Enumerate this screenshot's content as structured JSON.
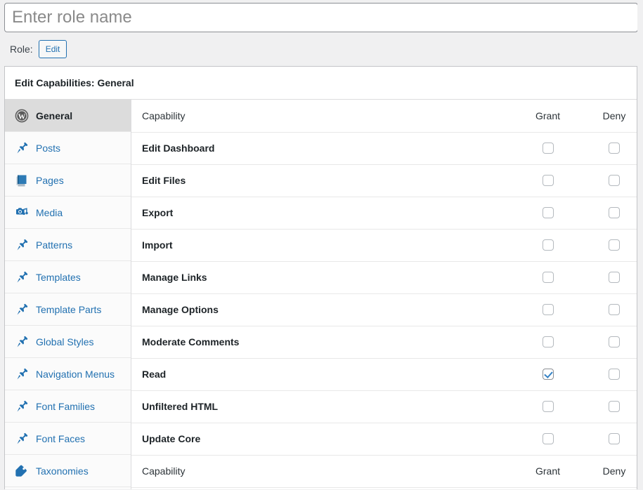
{
  "role_name_input": {
    "placeholder": "Enter role name",
    "value": ""
  },
  "role_line": {
    "label": "Role:",
    "edit_button": "Edit"
  },
  "panel": {
    "title": "Edit Capabilities: General"
  },
  "sidebar": {
    "items": [
      {
        "label": "General",
        "icon": "wordpress-icon",
        "active": true
      },
      {
        "label": "Posts",
        "icon": "pushpin-icon",
        "active": false
      },
      {
        "label": "Pages",
        "icon": "pages-icon",
        "active": false
      },
      {
        "label": "Media",
        "icon": "media-icon",
        "active": false
      },
      {
        "label": "Patterns",
        "icon": "pushpin-icon",
        "active": false
      },
      {
        "label": "Templates",
        "icon": "pushpin-icon",
        "active": false
      },
      {
        "label": "Template Parts",
        "icon": "pushpin-icon",
        "active": false
      },
      {
        "label": "Global Styles",
        "icon": "pushpin-icon",
        "active": false
      },
      {
        "label": "Navigation Menus",
        "icon": "pushpin-icon",
        "active": false
      },
      {
        "label": "Font Families",
        "icon": "pushpin-icon",
        "active": false
      },
      {
        "label": "Font Faces",
        "icon": "pushpin-icon",
        "active": false
      },
      {
        "label": "Taxonomies",
        "icon": "tag-icon",
        "active": false
      }
    ]
  },
  "table": {
    "headers": {
      "capability": "Capability",
      "grant": "Grant",
      "deny": "Deny"
    },
    "footers": {
      "capability": "Capability",
      "grant": "Grant",
      "deny": "Deny"
    },
    "rows": [
      {
        "capability": "Edit Dashboard",
        "grant": false,
        "deny": false
      },
      {
        "capability": "Edit Files",
        "grant": false,
        "deny": false
      },
      {
        "capability": "Export",
        "grant": false,
        "deny": false
      },
      {
        "capability": "Import",
        "grant": false,
        "deny": false
      },
      {
        "capability": "Manage Links",
        "grant": false,
        "deny": false
      },
      {
        "capability": "Manage Options",
        "grant": false,
        "deny": false
      },
      {
        "capability": "Moderate Comments",
        "grant": false,
        "deny": false
      },
      {
        "capability": "Read",
        "grant": true,
        "deny": false
      },
      {
        "capability": "Unfiltered HTML",
        "grant": false,
        "deny": false
      },
      {
        "capability": "Update Core",
        "grant": false,
        "deny": false
      }
    ]
  },
  "colors": {
    "link_blue": "#2271b1",
    "icon_blue": "#2271b1",
    "check_blue": "#3582c4",
    "page_bg": "#f0f0f1",
    "active_row_bg": "#dcdcdc"
  }
}
